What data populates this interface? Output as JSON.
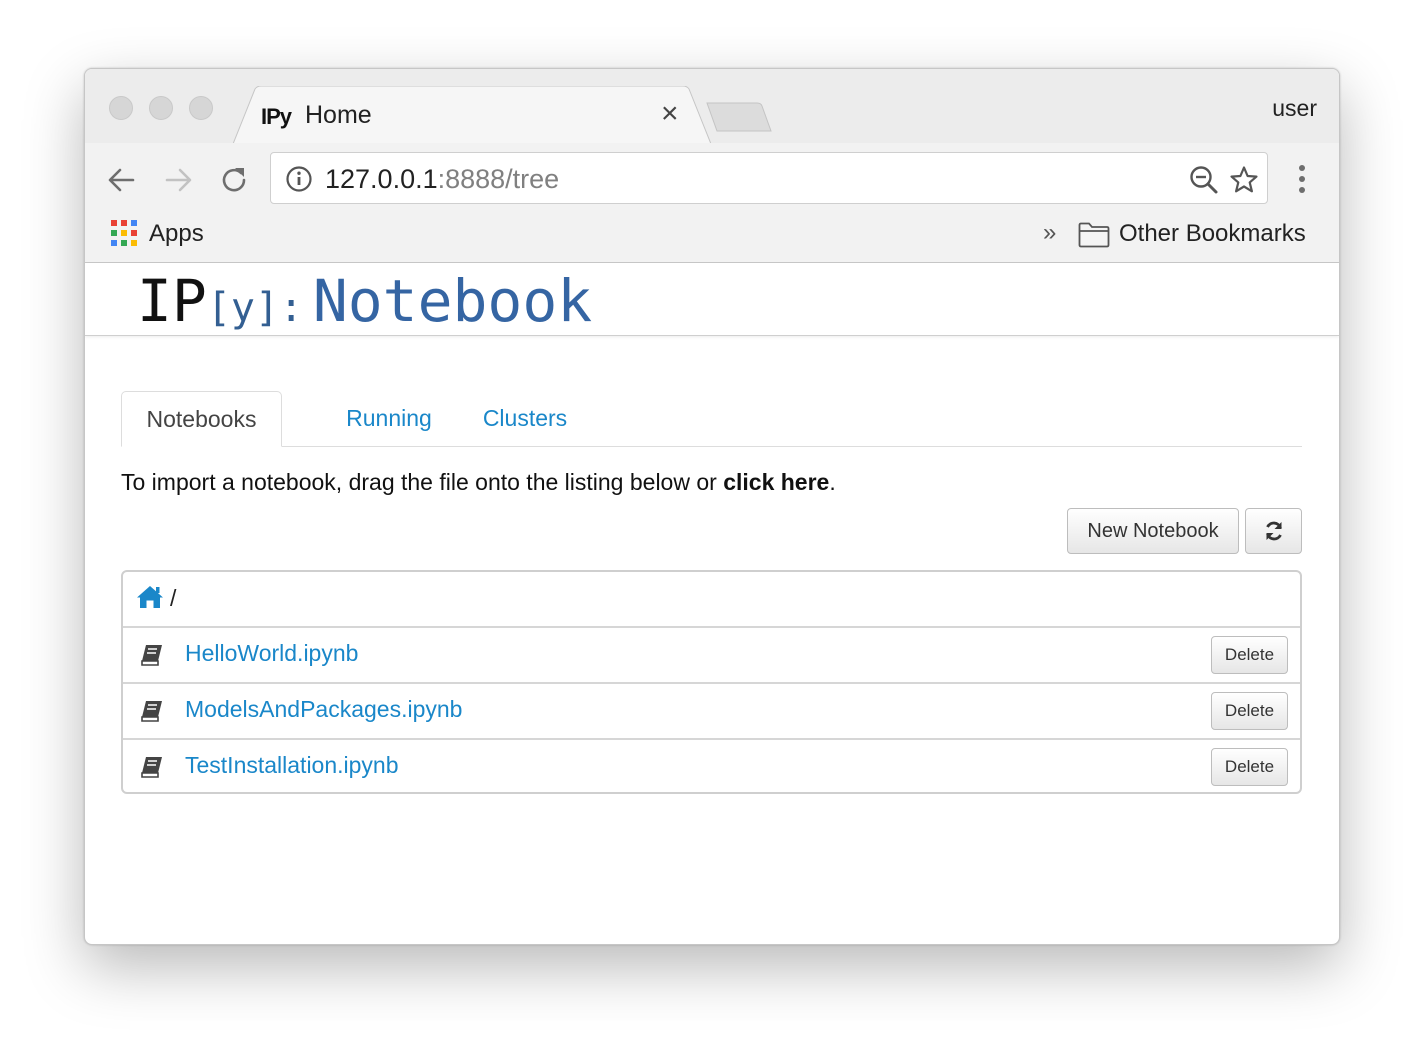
{
  "browser": {
    "tab": {
      "favicon_text": "IPy",
      "title": "Home"
    },
    "user_label": "user",
    "url": {
      "host": "127.0.0.1",
      "rest": ":8888/tree"
    },
    "bookmarks": {
      "apps_label": "Apps",
      "overflow": "»",
      "other_label": "Other Bookmarks"
    }
  },
  "header": {
    "logo_ip": "IP",
    "logo_y": "[y]:",
    "logo_notebook": "Notebook"
  },
  "tabs": [
    {
      "label": "Notebooks"
    },
    {
      "label": "Running"
    },
    {
      "label": "Clusters"
    }
  ],
  "import": {
    "prefix": "To import a notebook, drag the file onto the listing below or ",
    "link": "click here",
    "suffix": "."
  },
  "toolbar": {
    "new_notebook_label": "New Notebook"
  },
  "breadcrumb": {
    "separator": "/"
  },
  "files": [
    {
      "name": "HelloWorld.ipynb",
      "action": "Delete"
    },
    {
      "name": "ModelsAndPackages.ipynb",
      "action": "Delete"
    },
    {
      "name": "TestInstallation.ipynb",
      "action": "Delete"
    }
  ],
  "colors": {
    "link": "#1a87c9",
    "logo_blue": "#3565a3"
  }
}
